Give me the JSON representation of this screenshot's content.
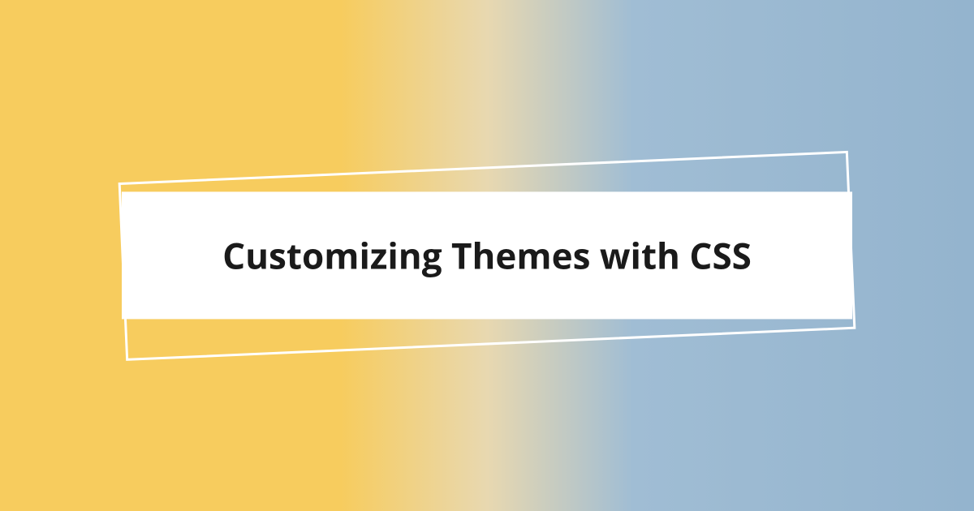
{
  "hero": {
    "title": "Customizing Themes with CSS"
  },
  "colors": {
    "gradient_left": "#f7cc5e",
    "gradient_right": "#94b4ce",
    "title_bg": "#ffffff",
    "title_text": "#1a1a1a",
    "outline": "#ffffff"
  }
}
